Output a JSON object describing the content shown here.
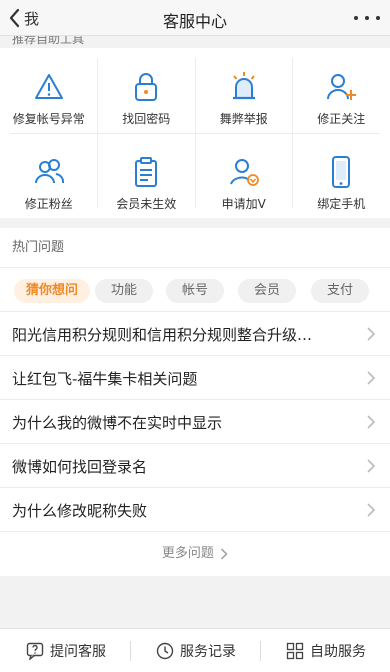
{
  "nav": {
    "back_label": "我",
    "title": "客服中心"
  },
  "self_service": {
    "heading": "推荐自助工具",
    "items": [
      {
        "label": "修复帐号异常",
        "icon": "warning-icon"
      },
      {
        "label": "找回密码",
        "icon": "lock-icon"
      },
      {
        "label": "舞弊举报",
        "icon": "siren-icon"
      },
      {
        "label": "修正关注",
        "icon": "add-user-icon"
      },
      {
        "label": "修正粉丝",
        "icon": "users-icon"
      },
      {
        "label": "会员未生效",
        "icon": "clipboard-icon"
      },
      {
        "label": "申请加V",
        "icon": "verified-user-icon"
      },
      {
        "label": "绑定手机",
        "icon": "phone-icon"
      }
    ]
  },
  "hot": {
    "heading": "热门问题",
    "tabs": [
      "猜你想问",
      "功能",
      "帐号",
      "会员",
      "支付"
    ],
    "active_tab": "猜你想问",
    "questions": [
      "阳光信用积分规则和信用积分规则整合升级…",
      "让红包飞-福牛集卡相关问题",
      "为什么我的微博不在实时中显示",
      "微博如何找回登录名",
      "为什么修改昵称失败"
    ],
    "more_label": "更多问题"
  },
  "footer": {
    "ask": "提问客服",
    "records": "服务记录",
    "self": "自助服务"
  },
  "colors": {
    "accent_blue": "#2a7fd4",
    "accent_orange": "#f08a24"
  }
}
